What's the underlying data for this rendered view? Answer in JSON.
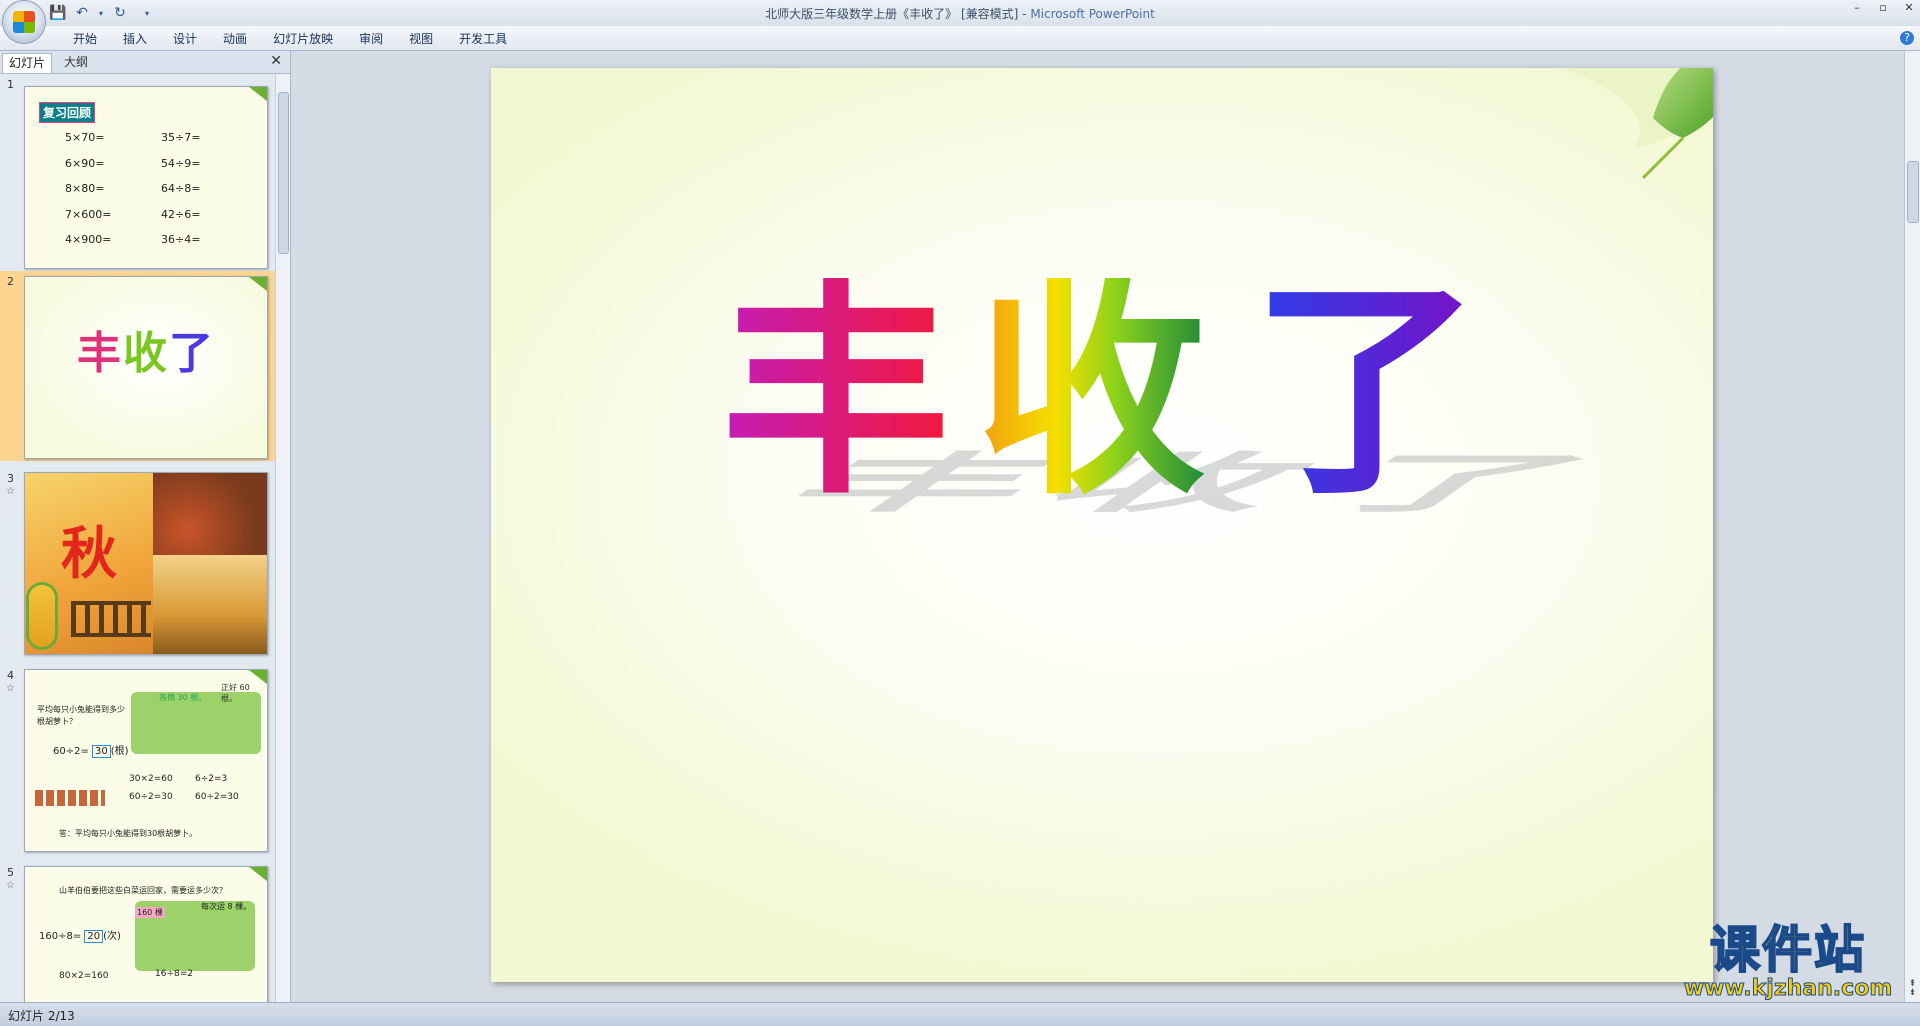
{
  "window": {
    "title_doc": "北师大版三年级数学上册《丰收了》 [兼容模式] - ",
    "title_app": "Microsoft PowerPoint",
    "controls": [
      "–",
      "▫",
      "✕"
    ]
  },
  "ribbon": {
    "tabs": [
      "开始",
      "插入",
      "设计",
      "动画",
      "幻灯片放映",
      "审阅",
      "视图",
      "开发工具"
    ],
    "help": "?"
  },
  "panel": {
    "tab_slides": "幻灯片",
    "tab_outline": "大纲",
    "close": "✕"
  },
  "thumbnails": [
    {
      "num": "1",
      "heading": "复习回顾",
      "left_col": [
        "5×70=",
        "6×90=",
        "8×80=",
        "7×600=",
        "4×900="
      ],
      "right_col": [
        "35÷7=",
        "54÷9=",
        "64÷8=",
        "42÷6=",
        "36÷4="
      ]
    },
    {
      "num": "2",
      "title": "丰收了"
    },
    {
      "num": "3",
      "star": "☆",
      "glyph": "秋"
    },
    {
      "num": "4",
      "star": "☆",
      "lines": [
        "平均每只小兔能得到多少根胡萝卜？",
        "60÷2=",
        "30",
        "(根)",
        "30×2=60",
        "60÷2=30",
        "6÷2=3",
        "60÷2=30",
        "答：平均每只小兔能得到30根胡萝卜。"
      ],
      "bubble1": "各摘 30 根。",
      "bubble2": "正好 60 根。"
    },
    {
      "num": "5",
      "star": "☆",
      "lines": [
        "山羊伯伯要把这些白菜运回家，需要运多少次？",
        "160÷8=",
        "20",
        "(次)",
        "80×2=160",
        "16÷8=2"
      ],
      "bubble1": "160 棵",
      "bubble2": "每次运 8 棵。"
    }
  ],
  "slide": {
    "title_chars": [
      "丰",
      "收",
      "了"
    ]
  },
  "watermark": {
    "title": "课件站",
    "url": "www.kjzhan.com"
  },
  "status": {
    "slide_info": "幻灯片 2/13"
  }
}
